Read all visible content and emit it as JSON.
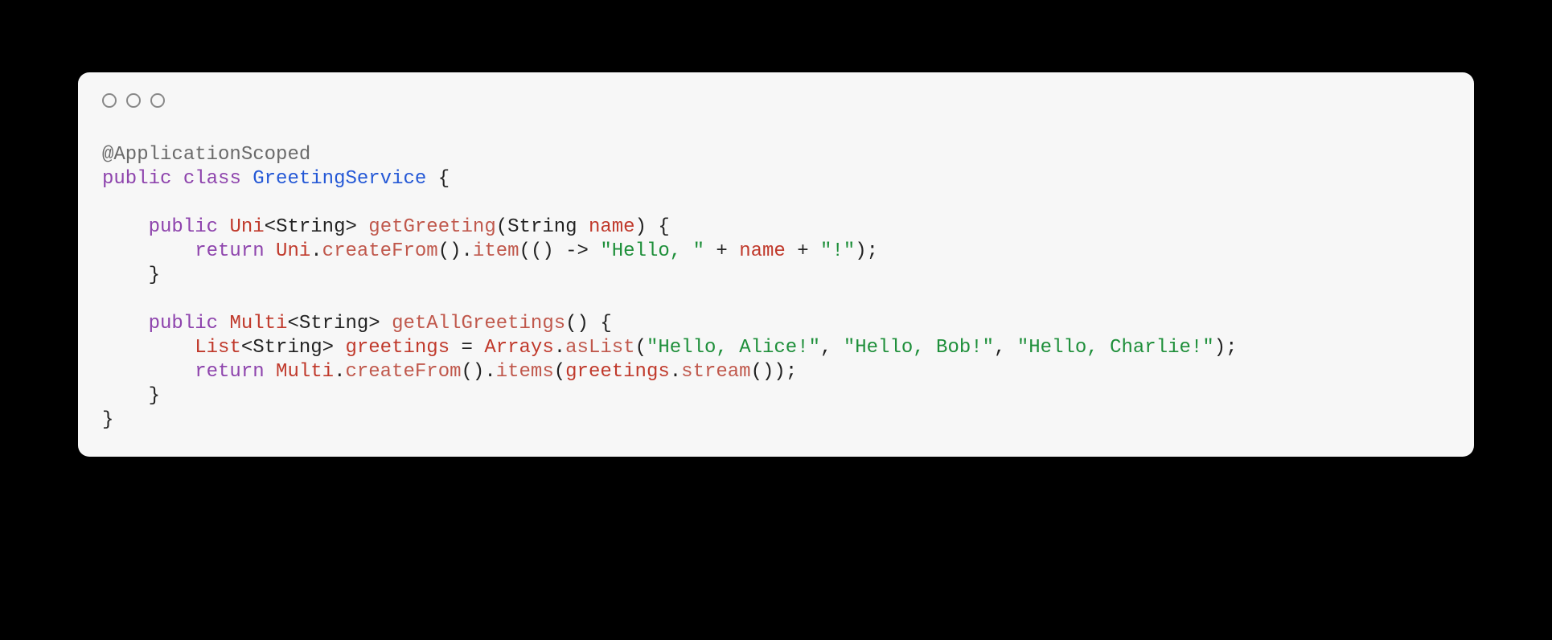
{
  "code": {
    "annotation": "@ApplicationScoped",
    "kw_public": "public",
    "kw_class": "class",
    "kw_return": "return",
    "className": "GreetingService",
    "typeUni": "Uni",
    "typeMulti": "Multi",
    "typeString": "String",
    "typeList": "List",
    "typeArrays": "Arrays",
    "fn_getGreeting": "getGreeting",
    "fn_getAllGreetings": "getAllGreetings",
    "fn_createFrom": "createFrom",
    "fn_item": "item",
    "fn_items": "items",
    "fn_asList": "asList",
    "fn_stream": "stream",
    "param_name": "name",
    "var_greetings": "greetings",
    "str_hello_comma": "\"Hello, \"",
    "str_bang": "\"!\"",
    "str_alice": "\"Hello, Alice!\"",
    "str_bob": "\"Hello, Bob!\"",
    "str_charlie": "\"Hello, Charlie!\"",
    "sym_lbrace": "{",
    "sym_rbrace": "}",
    "sym_lparen": "(",
    "sym_rparen": ")",
    "sym_lt": "<",
    "sym_gt": ">",
    "sym_semi": ";",
    "sym_dot": ".",
    "sym_comma": ",",
    "sym_plus": "+",
    "sym_eq": "=",
    "sym_arrow": "->"
  }
}
